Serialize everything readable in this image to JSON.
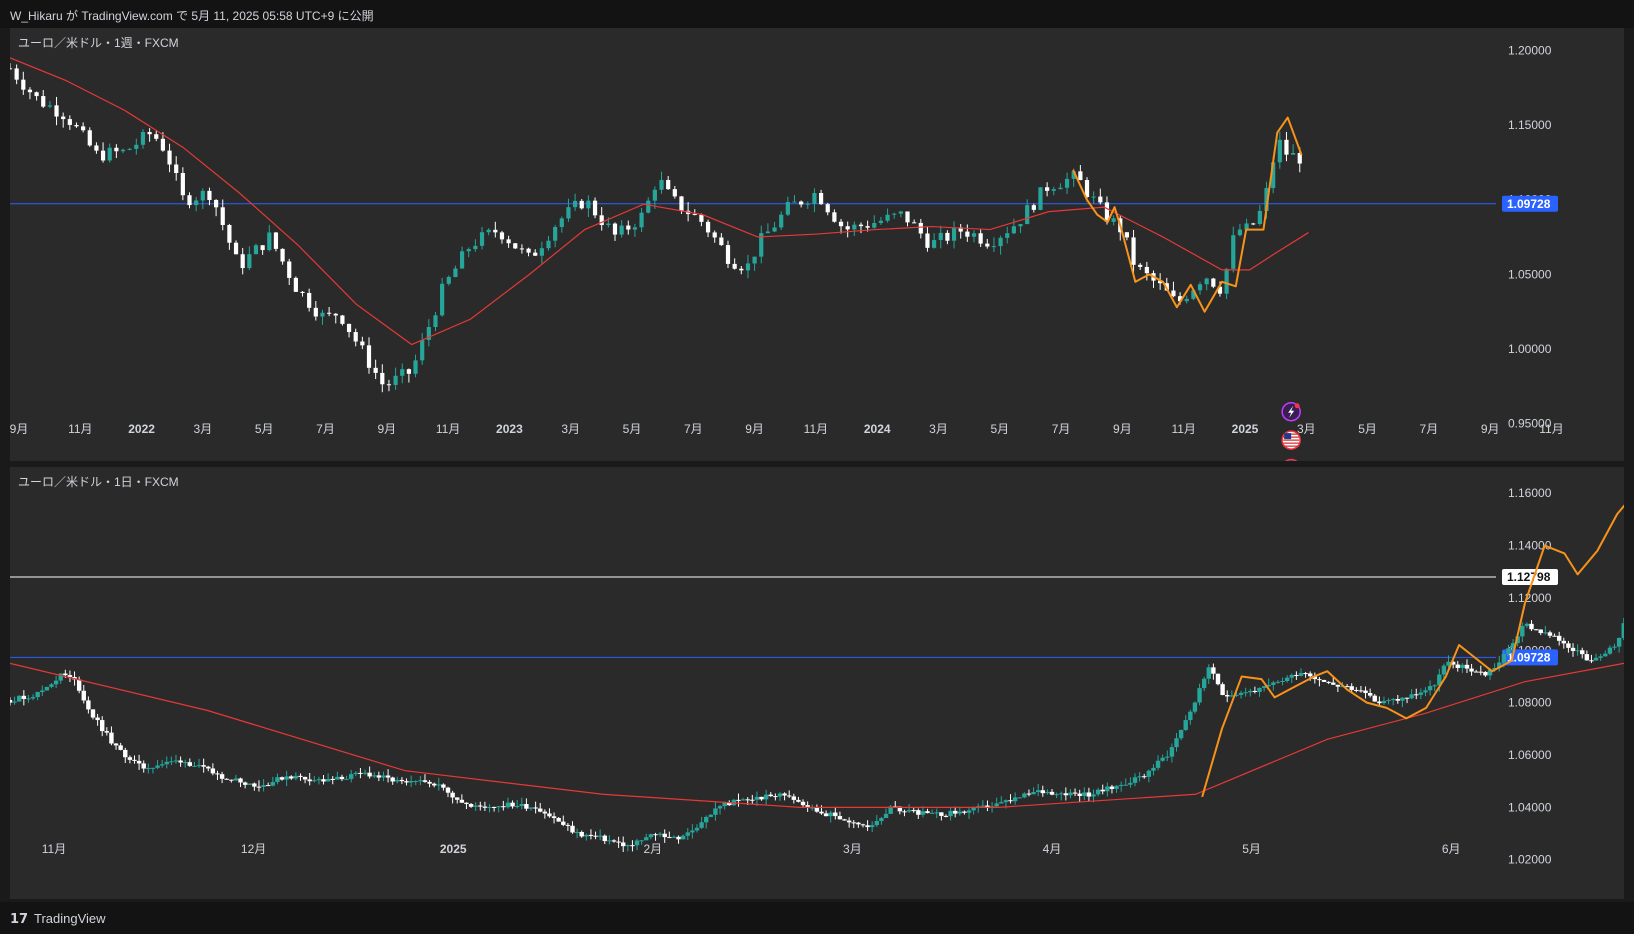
{
  "header": {
    "publish_text": "W_Hikaru が TradingView.com で 5月 11, 2025 05:58 UTC+9 に公開"
  },
  "footer": {
    "logo_mark": "𝟭𝟳",
    "brand": "TradingView"
  },
  "colors": {
    "background": "#2a2a2a",
    "up_candle": "#26a69a",
    "down_candle": "#ffffff",
    "moving_average": "#e53935",
    "overlay_line": "#f7931a",
    "horizontal_line_blue": "#2962ff",
    "horizontal_line_white": "#ffffff",
    "axis_text": "#d1d4dc"
  },
  "icons": [
    "lightning-icon",
    "us-flag-icon",
    "eu-flag-icon"
  ],
  "chart_data": [
    {
      "type": "candlestick",
      "title": "ユーロ／米ドル・1週・FXCM",
      "ylim": [
        0.925,
        1.215
      ],
      "y_ticks": [
        "1.20000",
        "1.15000",
        "1.10000",
        "1.05000",
        "1.00000",
        "0.95000"
      ],
      "x_labels": [
        "9月",
        "11月",
        "2022",
        "3月",
        "5月",
        "7月",
        "9月",
        "11月",
        "2023",
        "3月",
        "5月",
        "7月",
        "9月",
        "11月",
        "2024",
        "3月",
        "5月",
        "7月",
        "9月",
        "11月",
        "2025",
        "3月",
        "5月",
        "7月",
        "9月",
        "11月"
      ],
      "x_range": [
        2021.67,
        2025.95
      ],
      "horizontal_lines": [
        {
          "value": 1.09728,
          "label": "1.09728",
          "color": "#2962ff"
        }
      ],
      "series": [
        {
          "kind": "close_path",
          "points": [
            [
              2021.67,
              1.188
            ],
            [
              2021.75,
              1.167
            ],
            [
              2021.83,
              1.157
            ],
            [
              2021.92,
              1.13
            ],
            [
              2022.0,
              1.132
            ],
            [
              2022.08,
              1.145
            ],
            [
              2022.12,
              1.133
            ],
            [
              2022.17,
              1.1
            ],
            [
              2022.25,
              1.105
            ],
            [
              2022.33,
              1.055
            ],
            [
              2022.42,
              1.075
            ],
            [
              2022.5,
              1.04
            ],
            [
              2022.58,
              1.02
            ],
            [
              2022.62,
              1.025
            ],
            [
              2022.67,
              1.005
            ],
            [
              2022.75,
              0.975
            ],
            [
              2022.83,
              0.985
            ],
            [
              2022.92,
              1.04
            ],
            [
              2023.0,
              1.07
            ],
            [
              2023.08,
              1.08
            ],
            [
              2023.17,
              1.06
            ],
            [
              2023.25,
              1.085
            ],
            [
              2023.33,
              1.1
            ],
            [
              2023.42,
              1.075
            ],
            [
              2023.5,
              1.09
            ],
            [
              2023.54,
              1.115
            ],
            [
              2023.58,
              1.1
            ],
            [
              2023.67,
              1.085
            ],
            [
              2023.75,
              1.06
            ],
            [
              2023.8,
              1.055
            ],
            [
              2023.83,
              1.07
            ],
            [
              2023.92,
              1.095
            ],
            [
              2024.0,
              1.105
            ],
            [
              2024.08,
              1.08
            ],
            [
              2024.17,
              1.085
            ],
            [
              2024.25,
              1.09
            ],
            [
              2024.33,
              1.07
            ],
            [
              2024.42,
              1.08
            ],
            [
              2024.5,
              1.072
            ],
            [
              2024.58,
              1.085
            ],
            [
              2024.67,
              1.11
            ],
            [
              2024.75,
              1.115
            ],
            [
              2024.83,
              1.09
            ],
            [
              2024.88,
              1.08
            ],
            [
              2024.92,
              1.055
            ],
            [
              2025.0,
              1.04
            ],
            [
              2025.04,
              1.03
            ],
            [
              2025.08,
              1.04
            ],
            [
              2025.12,
              1.05
            ],
            [
              2025.17,
              1.04
            ],
            [
              2025.21,
              1.08
            ],
            [
              2025.25,
              1.08
            ],
            [
              2025.29,
              1.095
            ],
            [
              2025.33,
              1.14
            ],
            [
              2025.36,
              1.13
            ],
            [
              2025.4,
              1.128
            ]
          ]
        },
        {
          "kind": "moving_average",
          "points": [
            [
              2021.67,
              1.195
            ],
            [
              2021.83,
              1.18
            ],
            [
              2022.0,
              1.16
            ],
            [
              2022.17,
              1.135
            ],
            [
              2022.33,
              1.105
            ],
            [
              2022.5,
              1.07
            ],
            [
              2022.67,
              1.03
            ],
            [
              2022.83,
              1.003
            ],
            [
              2023.0,
              1.02
            ],
            [
              2023.17,
              1.05
            ],
            [
              2023.33,
              1.08
            ],
            [
              2023.5,
              1.097
            ],
            [
              2023.67,
              1.09
            ],
            [
              2023.83,
              1.075
            ],
            [
              2024.0,
              1.077
            ],
            [
              2024.17,
              1.08
            ],
            [
              2024.33,
              1.082
            ],
            [
              2024.5,
              1.08
            ],
            [
              2024.67,
              1.092
            ],
            [
              2024.83,
              1.095
            ],
            [
              2025.0,
              1.075
            ],
            [
              2025.17,
              1.053
            ],
            [
              2025.25,
              1.053
            ],
            [
              2025.33,
              1.065
            ],
            [
              2025.42,
              1.078
            ]
          ]
        },
        {
          "kind": "overlay",
          "points": [
            [
              2024.74,
              1.12
            ],
            [
              2024.78,
              1.1
            ],
            [
              2024.81,
              1.09
            ],
            [
              2024.84,
              1.085
            ],
            [
              2024.86,
              1.095
            ],
            [
              2024.88,
              1.08
            ],
            [
              2024.92,
              1.045
            ],
            [
              2024.96,
              1.05
            ],
            [
              2025.0,
              1.045
            ],
            [
              2025.04,
              1.028
            ],
            [
              2025.08,
              1.043
            ],
            [
              2025.12,
              1.025
            ],
            [
              2025.17,
              1.045
            ],
            [
              2025.21,
              1.042
            ],
            [
              2025.24,
              1.08
            ],
            [
              2025.29,
              1.08
            ],
            [
              2025.33,
              1.145
            ],
            [
              2025.36,
              1.155
            ],
            [
              2025.4,
              1.13
            ]
          ]
        }
      ],
      "icons": [
        {
          "name": "lightning-icon",
          "x": 2025.37,
          "y": 0.958
        },
        {
          "name": "us-flag-icon",
          "x": 2025.37,
          "y": 0.939
        },
        {
          "name": "eu-flag-icon",
          "x": 2025.37,
          "y": 0.92
        }
      ]
    },
    {
      "type": "candlestick",
      "title": "ユーロ／米ドル・1日・FXCM",
      "ylim": [
        1.005,
        1.17
      ],
      "y_ticks": [
        "1.16000",
        "1.14000",
        "1.12000",
        "1.10000",
        "1.08000",
        "1.06000",
        "1.04000",
        "1.02000"
      ],
      "x_labels": [
        "11月",
        "12月",
        "2025",
        "2月",
        "3月",
        "4月",
        "5月",
        "6月"
      ],
      "x_range": [
        0,
        225
      ],
      "horizontal_lines": [
        {
          "value": 1.12798,
          "label": "1.12798",
          "color": "#ffffff"
        },
        {
          "value": 1.09728,
          "label": "1.09728",
          "color": "#2962ff"
        }
      ],
      "series": [
        {
          "kind": "close_path",
          "points": [
            [
              0,
              1.081
            ],
            [
              4,
              1.083
            ],
            [
              8,
              1.091
            ],
            [
              10,
              1.088
            ],
            [
              12,
              1.077
            ],
            [
              16,
              1.063
            ],
            [
              20,
              1.055
            ],
            [
              26,
              1.058
            ],
            [
              32,
              1.052
            ],
            [
              38,
              1.048
            ],
            [
              42,
              1.052
            ],
            [
              48,
              1.05
            ],
            [
              54,
              1.053
            ],
            [
              60,
              1.049
            ],
            [
              64,
              1.05
            ],
            [
              70,
              1.04
            ],
            [
              76,
              1.041
            ],
            [
              80,
              1.04
            ],
            [
              86,
              1.03
            ],
            [
              90,
              1.028
            ],
            [
              94,
              1.025
            ],
            [
              98,
              1.03
            ],
            [
              102,
              1.028
            ],
            [
              108,
              1.041
            ],
            [
              112,
              1.043
            ],
            [
              118,
              1.045
            ],
            [
              122,
              1.039
            ],
            [
              126,
              1.036
            ],
            [
              130,
              1.032
            ],
            [
              134,
              1.04
            ],
            [
              140,
              1.037
            ],
            [
              144,
              1.038
            ],
            [
              150,
              1.041
            ],
            [
              156,
              1.046
            ],
            [
              164,
              1.045
            ],
            [
              168,
              1.048
            ],
            [
              172,
              1.052
            ],
            [
              176,
              1.061
            ],
            [
              180,
              1.081
            ],
            [
              182,
              1.094
            ],
            [
              184,
              1.083
            ],
            [
              190,
              1.085
            ],
            [
              196,
              1.092
            ],
            [
              200,
              1.088
            ],
            [
              204,
              1.085
            ],
            [
              208,
              1.08
            ],
            [
              212,
              1.082
            ],
            [
              216,
              1.086
            ],
            [
              218,
              1.095
            ],
            [
              220,
              1.094
            ],
            [
              224,
              1.091
            ],
            [
              226,
              1.095
            ],
            [
              230,
              1.11
            ],
            [
              236,
              1.103
            ],
            [
              240,
              1.095
            ],
            [
              244,
              1.102
            ],
            [
              248,
              1.135
            ],
            [
              250,
              1.142
            ],
            [
              254,
              1.135
            ],
            [
              258,
              1.142
            ],
            [
              262,
              1.145
            ],
            [
              266,
              1.134
            ],
            [
              270,
              1.137
            ],
            [
              274,
              1.134
            ],
            [
              278,
              1.13
            ],
            [
              282,
              1.128
            ],
            [
              286,
              1.131
            ],
            [
              290,
              1.125
            ]
          ]
        },
        {
          "kind": "moving_average",
          "points": [
            [
              0,
              1.095
            ],
            [
              30,
              1.077
            ],
            [
              60,
              1.054
            ],
            [
              90,
              1.045
            ],
            [
              120,
              1.04
            ],
            [
              150,
              1.04
            ],
            [
              180,
              1.045
            ],
            [
              200,
              1.066
            ],
            [
              215,
              1.076
            ],
            [
              230,
              1.088
            ],
            [
              245,
              1.095
            ],
            [
              260,
              1.11
            ],
            [
              275,
              1.122
            ],
            [
              290,
              1.13
            ],
            [
              300,
              1.133
            ]
          ]
        },
        {
          "kind": "overlay",
          "points": [
            [
              181,
              1.044
            ],
            [
              184,
              1.07
            ],
            [
              187,
              1.09
            ],
            [
              190,
              1.089
            ],
            [
              192,
              1.082
            ],
            [
              195,
              1.086
            ],
            [
              198,
              1.09
            ],
            [
              200,
              1.092
            ],
            [
              203,
              1.085
            ],
            [
              206,
              1.08
            ],
            [
              209,
              1.078
            ],
            [
              212,
              1.074
            ],
            [
              215,
              1.078
            ],
            [
              218,
              1.09
            ],
            [
              220,
              1.102
            ],
            [
              222,
              1.098
            ],
            [
              225,
              1.092
            ],
            [
              228,
              1.096
            ],
            [
              230,
              1.118
            ],
            [
              233,
              1.14
            ],
            [
              236,
              1.137
            ],
            [
              238,
              1.129
            ],
            [
              241,
              1.138
            ],
            [
              244,
              1.152
            ],
            [
              246,
              1.158
            ],
            [
              249,
              1.137
            ],
            [
              251,
              1.132
            ],
            [
              254,
              1.135
            ],
            [
              257,
              1.138
            ],
            [
              259,
              1.143
            ],
            [
              262,
              1.138
            ],
            [
              265,
              1.133
            ],
            [
              267,
              1.134
            ],
            [
              270,
              1.136
            ],
            [
              273,
              1.13
            ],
            [
              276,
              1.128
            ],
            [
              279,
              1.126
            ]
          ]
        }
      ],
      "icons": [
        {
          "name": "eu-flag-icon",
          "x": 278,
          "y": 1.018
        },
        {
          "name": "lightning-icon",
          "x": 274,
          "y": 1.008
        },
        {
          "name": "us-flag-icon",
          "x": 277,
          "y": 1.008
        },
        {
          "name": "us-flag-icon",
          "x": 281,
          "y": 1.008
        },
        {
          "name": "us-flag-icon",
          "x": 283,
          "y": 1.008
        }
      ]
    }
  ]
}
